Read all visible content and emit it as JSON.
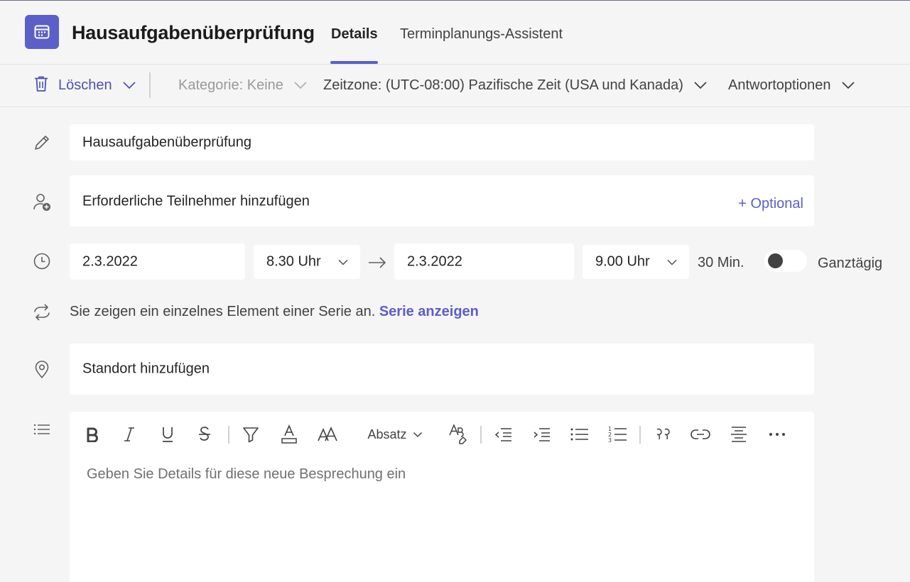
{
  "header": {
    "title": "Hausaufgabenüberprüfung",
    "tabs": [
      {
        "label": "Details",
        "active": true
      },
      {
        "label": "Terminplanungs-Assistent",
        "active": false
      }
    ]
  },
  "toolbar": {
    "delete_label": "Löschen",
    "category_label": "Kategorie: Keine",
    "timezone_label": "Zeitzone: (UTC-08:00) Pazifische Zeit (USA und Kanada)",
    "response_options_label": "Antwortoptionen"
  },
  "form": {
    "title_value": "Hausaufgabenüberprüfung",
    "attendees_placeholder": "Erforderliche Teilnehmer hinzufügen",
    "optional_label": "+ Optional",
    "start_date": "2.3.2022",
    "start_time": "8.30 Uhr",
    "end_date": "2.3.2022",
    "end_time": "9.00 Uhr",
    "duration": "30 Min.",
    "all_day_label": "Ganztägig",
    "all_day_on": false,
    "series_text": "Sie zeigen ein einzelnes Element einer Serie an.",
    "series_link": "Serie anzeigen",
    "location_placeholder": "Standort hinzufügen"
  },
  "editor": {
    "paragraph_style": "Absatz",
    "placeholder": "Geben Sie Details für diese neue Besprechung ein",
    "tools": [
      "bold-icon",
      "italic-icon",
      "underline-icon",
      "strikethrough-icon",
      "highlight-icon",
      "font-color-icon",
      "font-size-icon",
      "paragraph-style-dropdown",
      "clear-formatting-icon",
      "decrease-indent-icon",
      "increase-indent-icon",
      "bulleted-list-icon",
      "numbered-list-icon",
      "quote-icon",
      "link-icon",
      "align-icon",
      "more-icon"
    ]
  },
  "colors": {
    "accent": "#5b5fc7",
    "background": "#f5f5f5",
    "field": "#ffffff"
  }
}
